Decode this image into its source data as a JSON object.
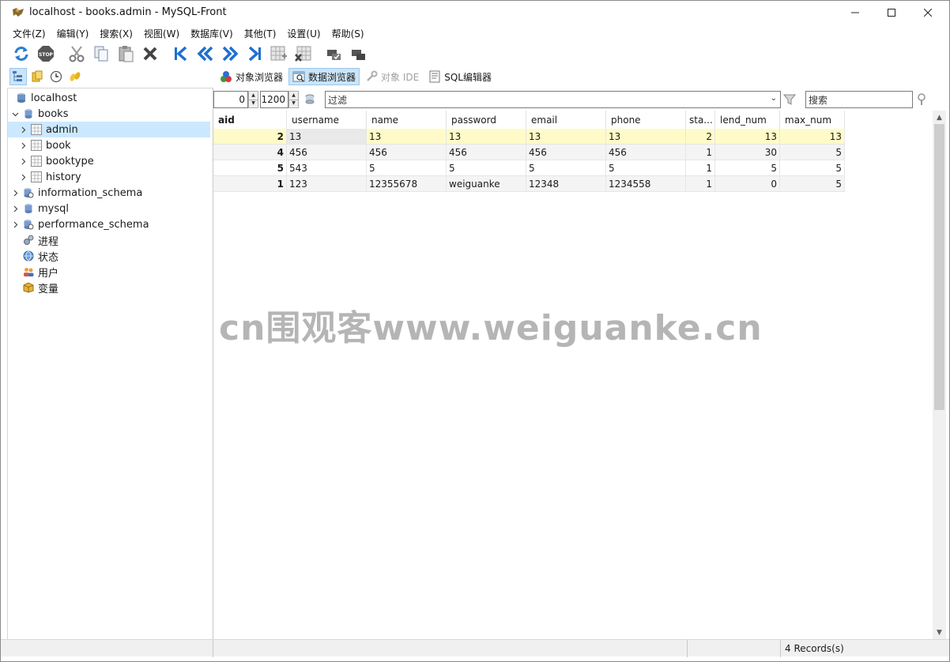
{
  "window": {
    "title": "localhost - books.admin - MySQL-Front"
  },
  "menubar": {
    "items": [
      "文件(Z)",
      "编辑(Y)",
      "搜索(X)",
      "视图(W)",
      "数据库(V)",
      "其他(T)",
      "设置(U)",
      "帮助(S)"
    ]
  },
  "toolbar": {
    "buttons": [
      "refresh-icon",
      "stop-icon",
      "cut-icon",
      "copy-icon",
      "paste-icon",
      "delete-icon",
      "first-icon",
      "prev-page-icon",
      "next-page-icon",
      "last-icon",
      "insert-record-icon",
      "delete-record-icon",
      "commit-icon",
      "rollback-icon"
    ]
  },
  "view_tabs": [
    {
      "label": "对象浏览器",
      "active": false,
      "disabled": false
    },
    {
      "label": "数据浏览器",
      "active": true,
      "disabled": false
    },
    {
      "label": "对象 IDE",
      "active": false,
      "disabled": true
    },
    {
      "label": "SQL编辑器",
      "active": false,
      "disabled": false
    }
  ],
  "tree": {
    "items": [
      {
        "label": "localhost",
        "icon": "server-icon",
        "level": 0,
        "chevron": ""
      },
      {
        "label": "books",
        "icon": "database-icon",
        "level": 0,
        "chevron": "expanded"
      },
      {
        "label": "admin",
        "icon": "table-icon",
        "level": 1,
        "chevron": "collapsed",
        "selected": true
      },
      {
        "label": "book",
        "icon": "table-icon",
        "level": 1,
        "chevron": "collapsed"
      },
      {
        "label": "booktype",
        "icon": "table-icon",
        "level": 1,
        "chevron": "collapsed"
      },
      {
        "label": "history",
        "icon": "table-icon",
        "level": 1,
        "chevron": "collapsed"
      },
      {
        "label": "information_schema",
        "icon": "system-database-icon",
        "level": 0,
        "chevron": "collapsed"
      },
      {
        "label": "mysql",
        "icon": "database-icon",
        "level": 0,
        "chevron": "collapsed"
      },
      {
        "label": "performance_schema",
        "icon": "system-database-icon",
        "level": 0,
        "chevron": "collapsed"
      },
      {
        "label": "进程",
        "icon": "processes-icon",
        "level": 0,
        "chevron": ""
      },
      {
        "label": "状态",
        "icon": "status-icon",
        "level": 0,
        "chevron": ""
      },
      {
        "label": "用户",
        "icon": "users-icon",
        "level": 0,
        "chevron": ""
      },
      {
        "label": "变量",
        "icon": "variables-icon",
        "level": 0,
        "chevron": ""
      }
    ]
  },
  "filter": {
    "offset": "0",
    "limit": "1200",
    "filter_placeholder": "过滤",
    "search_placeholder": "搜索"
  },
  "grid": {
    "columns": [
      "aid",
      "username",
      "name",
      "password",
      "email",
      "phone",
      "sta...",
      "lend_num",
      "max_num"
    ],
    "rows": [
      [
        "2",
        "13",
        "13",
        "13",
        "13",
        "13",
        "2",
        "13",
        "13"
      ],
      [
        "4",
        "456",
        "456",
        "456",
        "456",
        "456",
        "1",
        "30",
        "5"
      ],
      [
        "5",
        "543",
        "5",
        "5",
        "5",
        "5",
        "1",
        "5",
        "5"
      ],
      [
        "1",
        "123",
        "12355678",
        "weiguanke",
        "12348",
        "1234558",
        "1",
        "0",
        "5"
      ]
    ],
    "selected_row": 0,
    "sorted_column": "password"
  },
  "status": {
    "records": "4 Records(s)"
  },
  "watermark": "cn围观客www.weiguanke.cn",
  "colors": {
    "selected_row": "#fffbc8",
    "tree_selection": "#cce8ff",
    "accent_blue": "#1e6fd0"
  }
}
